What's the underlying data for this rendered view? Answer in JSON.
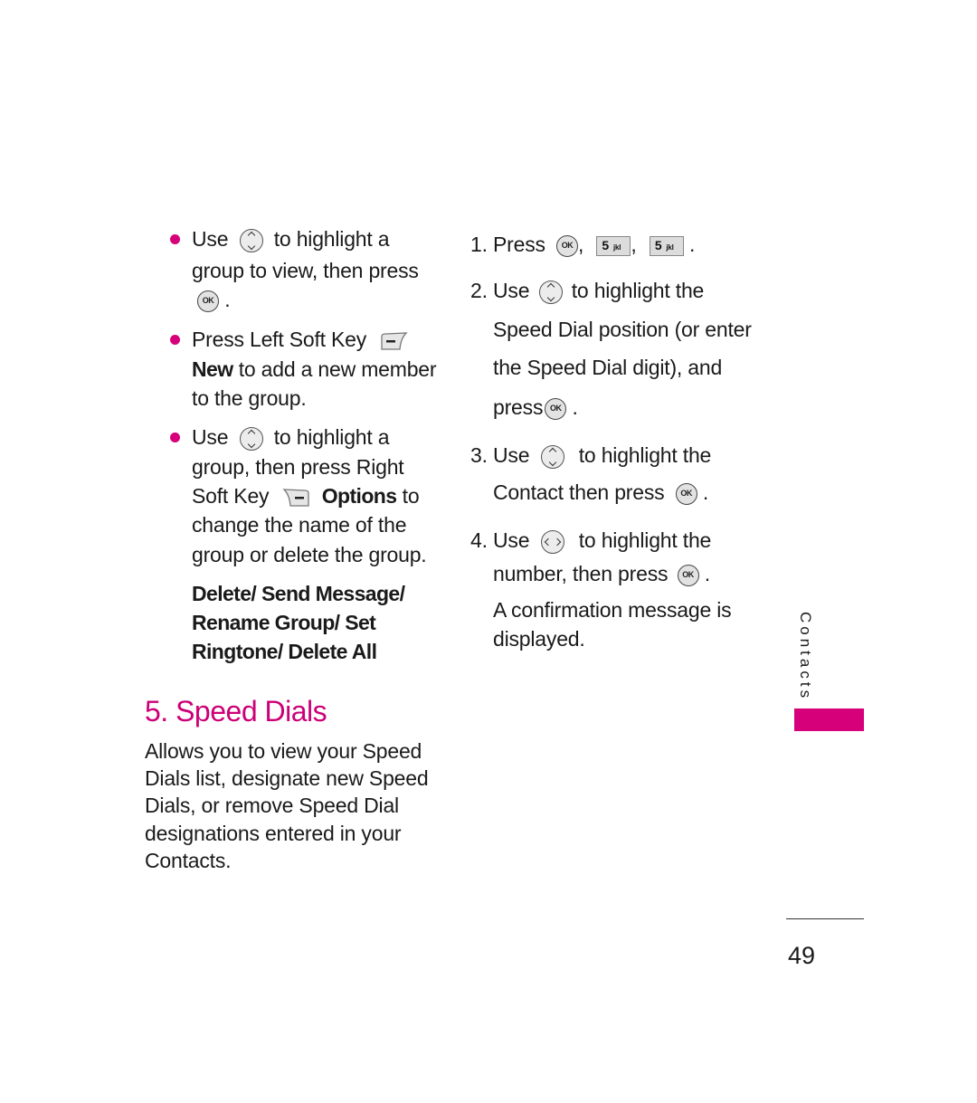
{
  "colors": {
    "accent": "#d6007a",
    "heading": "#cc0077"
  },
  "left_column": {
    "bullets": [
      {
        "line1_before": "Use",
        "line1_icon": "nav-up-down-icon",
        "line1_after": "to highlight a",
        "line2": "group to view, then press",
        "line3_icon": "ok-key-icon",
        "line3_after": "."
      },
      {
        "line1_before": "Press Left Soft Key",
        "line1_icon": "left-soft-key-icon",
        "line2_bold": "New",
        "line2_after": " to add a  new member",
        "line3": "to the group."
      },
      {
        "line1_before": "Use",
        "line1_icon": "nav-up-down-icon",
        "line1_after": "to highlight a",
        "line2": "group, then press Right",
        "line3_before": "Soft Key",
        "line3_icon": "right-soft-key-icon",
        "line3_bold": "Options",
        "line3_after": " to",
        "line4": "change the name of the",
        "line5": "group or delete the group."
      }
    ],
    "options_list": [
      "Delete/ Send Message/",
      "Rename Group/ Set",
      "Ringtone/ Delete All"
    ],
    "section_heading": "5. Speed Dials",
    "section_body": [
      "Allows you to view your Speed",
      "Dials list, designate new Speed",
      "Dials, or remove Speed Dial",
      "designations entered in your",
      "Contacts."
    ]
  },
  "right_column": {
    "steps": [
      {
        "num": "1.",
        "text": "Press",
        "keys": [
          "OK",
          "5",
          "5"
        ],
        "key_sub": "jkl"
      },
      {
        "num": "2.",
        "before": "Use",
        "after": "to highlight the",
        "lines": [
          "Speed Dial position (or enter",
          "the Speed Dial digit), and"
        ],
        "press": "press"
      },
      {
        "num": "3.",
        "before": "Use",
        "after": "to highlight the",
        "line2": "Contact then press"
      },
      {
        "num": "4.",
        "before": "Use",
        "after": "to highlight the",
        "line2": "number, then press",
        "note": [
          "A confirmation message is",
          "displayed."
        ]
      }
    ]
  },
  "ok_label": "OK",
  "side_tab": {
    "label": "Contacts"
  },
  "footer": {
    "page_number": "49"
  }
}
